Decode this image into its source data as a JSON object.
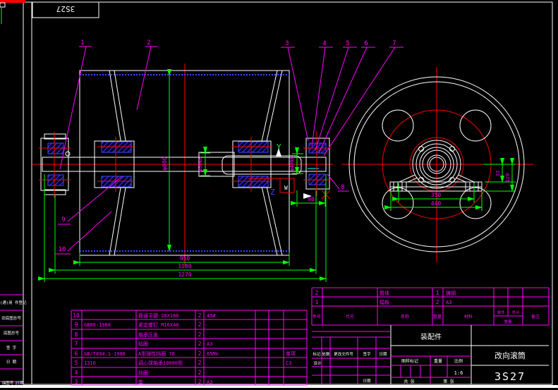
{
  "corner_code": "3S27",
  "sidebar": {
    "rows": [
      "借(通)用 件登记",
      "旧底图总号",
      "底图总号",
      "签 字",
      "日 期"
    ],
    "bottom_left": "描图号",
    "bottom_right": "日期"
  },
  "balloons": [
    "1",
    "2",
    "3",
    "4",
    "5",
    "6",
    "7",
    "8",
    "9",
    "10"
  ],
  "axes": {
    "y": "Y",
    "z": "Z",
    "w": "W"
  },
  "dims": {
    "phi800": "φ800",
    "phi50": "φ50k6",
    "phi40": "φ40k6",
    "d90": "90",
    "d950": "950",
    "d1180": "1180",
    "d1270": "1270",
    "d350": "350",
    "d440": "440",
    "d33": "33",
    "d120": "120"
  },
  "colors": {
    "accent_magenta": "#ff00ff",
    "line_white": "#ffffff",
    "dim_green": "#00ff00",
    "center_red": "#ff0000",
    "lagging_blue": "#4444ff"
  },
  "bom_left": {
    "rows": [
      {
        "seq": "10",
        "code": "",
        "name": "普通平键 28X160",
        "qty": "2",
        "material": "45#",
        "remark": ""
      },
      {
        "seq": "9",
        "code": "GB86-1988",
        "name": "紧定螺钉 M16X40",
        "qty": "2",
        "material": "",
        "remark": ""
      },
      {
        "seq": "8",
        "code": "",
        "name": "轴承压盖",
        "qty": "2",
        "material": "",
        "remark": ""
      },
      {
        "seq": "7",
        "code": "",
        "name": "毡圈",
        "qty": "2",
        "material": "A3",
        "remark": ""
      },
      {
        "seq": "6",
        "code": "GB/T894.1-1986",
        "name": "A型弹性挡圈 78",
        "qty": "2",
        "material": "65Mn",
        "remark": "单项"
      },
      {
        "seq": "5",
        "code": "1316",
        "name": "调心球轴承10000型",
        "qty": "2",
        "material": "",
        "remark": "C3"
      },
      {
        "seq": "4",
        "code": "",
        "name": "挡圈",
        "qty": "2",
        "material": "",
        "remark": ""
      },
      {
        "seq": "3",
        "code": "",
        "name": "套",
        "qty": "2",
        "material": "A3",
        "remark": ""
      }
    ]
  },
  "bom_right": {
    "rows": [
      {
        "seq": "2",
        "code": "",
        "name": "筒体",
        "qty": "1",
        "material": "铸钢",
        "remark": ""
      },
      {
        "seq": "1",
        "code": "",
        "name": "幅板",
        "qty": "2",
        "material": "A3",
        "remark": ""
      }
    ],
    "header": {
      "seq": "件号",
      "code": "代号",
      "name": "名称",
      "qty": "数量",
      "material": "材料",
      "unit": "单件",
      "total": "总计",
      "weight": "重量",
      "remark": "备注"
    }
  },
  "titleblock": {
    "type_label": "装配件",
    "part_name": "改向滚筒",
    "drawing_no": "3S27",
    "change_header": {
      "mark": "标记",
      "count": "处数",
      "doc": "更改文件号",
      "sign": "签字",
      "date": "日期"
    },
    "design_label": "设计",
    "date_label": "日期",
    "stamp_header": {
      "mark": "图样标记",
      "weight": "重量",
      "scale": "比例"
    },
    "scale_value": "1:6",
    "sheets_total": "共 张",
    "sheet_no": "第 张"
  }
}
